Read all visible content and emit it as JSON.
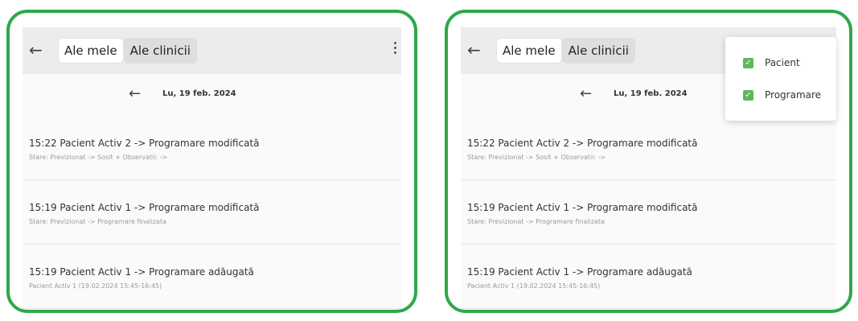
{
  "left": {
    "tabs": [
      {
        "label": "Ale mele"
      },
      {
        "label": "Ale clinicii"
      }
    ],
    "date": "Lu, 19 feb. 2024",
    "entries": [
      {
        "title": "15:22 Pacient Activ 2 -> Programare modificată",
        "detail": "Stare: Previzionat -> Sosit + Observatii: ->"
      },
      {
        "title": "15:19 Pacient Activ 1 -> Programare modificată",
        "detail": "Stare: Previzionat -> Programare finalizata"
      },
      {
        "title": "15:19 Pacient Activ 1 -> Programare adăugată",
        "detail": "Pacient Activ 1 (19.02.2024 15:45-16:45)"
      }
    ]
  },
  "right": {
    "tabs": [
      {
        "label": "Ale mele"
      },
      {
        "label": "Ale clinicii"
      }
    ],
    "date": "Lu, 19 feb. 2024",
    "entries": [
      {
        "title": "15:22 Pacient Activ 2 -> Programare modificată",
        "detail": "Stare: Previzionat -> Sosit + Observatii: ->"
      },
      {
        "title": "15:19 Pacient Activ 1 -> Programare modificată",
        "detail": "Stare: Previzionat -> Programare finalizata"
      },
      {
        "title": "15:19 Pacient Activ 1 -> Programare adăugată",
        "detail": "Pacient Activ 1 (19.02.2024 15:45-16:45)"
      }
    ],
    "filter_menu": {
      "items": [
        {
          "label": "Pacient",
          "checked": true
        },
        {
          "label": "Programare",
          "checked": true
        }
      ]
    }
  },
  "colors": {
    "frame": "#2ea84c",
    "checkbox": "#5cb85c",
    "toolbar": "#ececec"
  },
  "icons": {
    "back": "arrow-left-icon",
    "menu": "more-vert-icon",
    "check": "checkbox-checked-icon"
  }
}
